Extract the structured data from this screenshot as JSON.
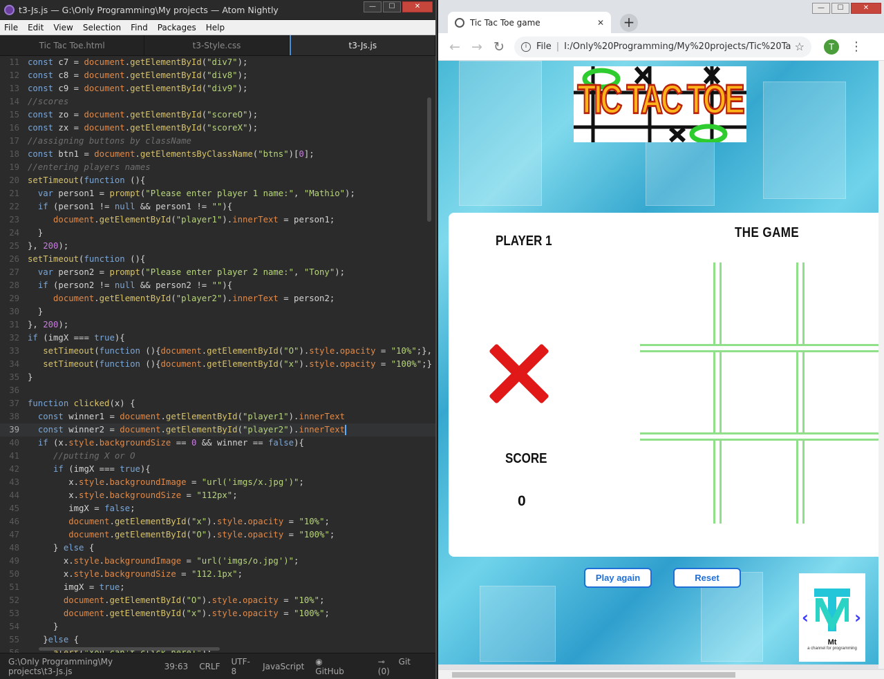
{
  "atom": {
    "title": "t3-Js.js — G:\\Only Programming\\My projects — Atom Nightly",
    "window_buttons": [
      "—",
      "☐",
      "✕"
    ],
    "menu": [
      "File",
      "Edit",
      "View",
      "Selection",
      "Find",
      "Packages",
      "Help"
    ],
    "tabs": [
      {
        "label": "Tic Tac Toe.html",
        "active": false
      },
      {
        "label": "t3-Style.css",
        "active": false
      },
      {
        "label": "t3-Js.js",
        "active": true
      }
    ],
    "code": [
      {
        "n": "11",
        "t": "const c7 = document.getElementById(\"div7\");"
      },
      {
        "n": "12",
        "t": "const c8 = document.getElementById(\"div8\");"
      },
      {
        "n": "13",
        "t": "const c9 = document.getElementById(\"div9\");"
      },
      {
        "n": "14",
        "t": "//scores"
      },
      {
        "n": "15",
        "t": "const zo = document.getElementById(\"scoreO\");"
      },
      {
        "n": "16",
        "t": "const zx = document.getElementById(\"scoreX\");"
      },
      {
        "n": "17",
        "t": "//assigning buttons by className"
      },
      {
        "n": "18",
        "t": "const btn1 = document.getElementsByClassName(\"btns\")[0];"
      },
      {
        "n": "19",
        "t": "//entering players names"
      },
      {
        "n": "20",
        "t": "setTimeout(function (){"
      },
      {
        "n": "21",
        "t": "  var person1 = prompt(\"Please enter player 1 name:\", \"Mathio\");"
      },
      {
        "n": "22",
        "t": "  if (person1 != null && person1 != \"\"){"
      },
      {
        "n": "23",
        "t": "     document.getElementById(\"player1\").innerText = person1;"
      },
      {
        "n": "24",
        "t": "  }"
      },
      {
        "n": "25",
        "t": "}, 200);"
      },
      {
        "n": "26",
        "t": "setTimeout(function (){"
      },
      {
        "n": "27",
        "t": "  var person2 = prompt(\"Please enter player 2 name:\", \"Tony\");"
      },
      {
        "n": "28",
        "t": "  if (person2 != null && person2 != \"\"){"
      },
      {
        "n": "29",
        "t": "     document.getElementById(\"player2\").innerText = person2;"
      },
      {
        "n": "30",
        "t": "  }"
      },
      {
        "n": "31",
        "t": "}, 200);"
      },
      {
        "n": "32",
        "t": "if (imgX === true){"
      },
      {
        "n": "33",
        "t": "   setTimeout(function (){document.getElementById(\"O\").style.opacity = \"10%\";},"
      },
      {
        "n": "34",
        "t": "   setTimeout(function (){document.getElementById(\"x\").style.opacity = \"100%\";}"
      },
      {
        "n": "35",
        "t": "}"
      },
      {
        "n": "36",
        "t": ""
      },
      {
        "n": "37",
        "t": "function clicked(x) {"
      },
      {
        "n": "38",
        "t": "  const winner1 = document.getElementById(\"player1\").innerText"
      },
      {
        "n": "39",
        "t": "  const winner2 = document.getElementById(\"player2\").innerText"
      },
      {
        "n": "40",
        "t": "  if (x.style.backgroundSize == 0 && winner == false){"
      },
      {
        "n": "41",
        "t": "     //putting X or O"
      },
      {
        "n": "42",
        "t": "     if (imgX === true){"
      },
      {
        "n": "43",
        "t": "        x.style.backgroundImage = \"url('imgs/x.jpg')\";"
      },
      {
        "n": "44",
        "t": "        x.style.backgroundSize = \"112px\";"
      },
      {
        "n": "45",
        "t": "        imgX = false;"
      },
      {
        "n": "46",
        "t": "        document.getElementById(\"x\").style.opacity = \"10%\";"
      },
      {
        "n": "47",
        "t": "        document.getElementById(\"O\").style.opacity = \"100%\";"
      },
      {
        "n": "48",
        "t": "     } else {"
      },
      {
        "n": "49",
        "t": "       x.style.backgroundImage = \"url('imgs/o.jpg')\";"
      },
      {
        "n": "50",
        "t": "       x.style.backgroundSize = \"112.1px\";"
      },
      {
        "n": "51",
        "t": "       imgX = true;"
      },
      {
        "n": "52",
        "t": "       document.getElementById(\"O\").style.opacity = \"10%\";"
      },
      {
        "n": "53",
        "t": "       document.getElementById(\"x\").style.opacity = \"100%\";"
      },
      {
        "n": "54",
        "t": "     }"
      },
      {
        "n": "55",
        "t": "   }else {"
      },
      {
        "n": "56",
        "t": "     alert(\"You can't click here!\");"
      }
    ],
    "current_line": "39",
    "status": {
      "path": "G:\\Only Programming\\My projects\\t3-Js.js",
      "cursor": "39:63",
      "line_ending": "CRLF",
      "encoding": "UTF-8",
      "grammar": "JavaScript",
      "github": "GitHub",
      "git": "Git (0)"
    }
  },
  "chrome": {
    "tab_title": "Tic Tac Toe game",
    "tab_close": "✕",
    "new_tab": "+",
    "window_buttons": [
      "—",
      "☐",
      "✕"
    ],
    "file_label": "File",
    "url": "I:/Only%20Programming/My%20projects/Tic%20Ta...",
    "avatar_letter": "T",
    "page": {
      "logo_text": "TIC TAC TOE",
      "game_title": "THE GAME",
      "player_label": "PLAYER 1",
      "score_label": "SCORE",
      "score_value": "0",
      "play_again": "Play again",
      "reset": "Reset",
      "badge_text": "Mt",
      "badge_sub": "a channel for programming"
    }
  },
  "colors": {
    "accent_blue": "#1f6fd6",
    "grid_green": "#90e08a",
    "x_red": "#e01818"
  }
}
